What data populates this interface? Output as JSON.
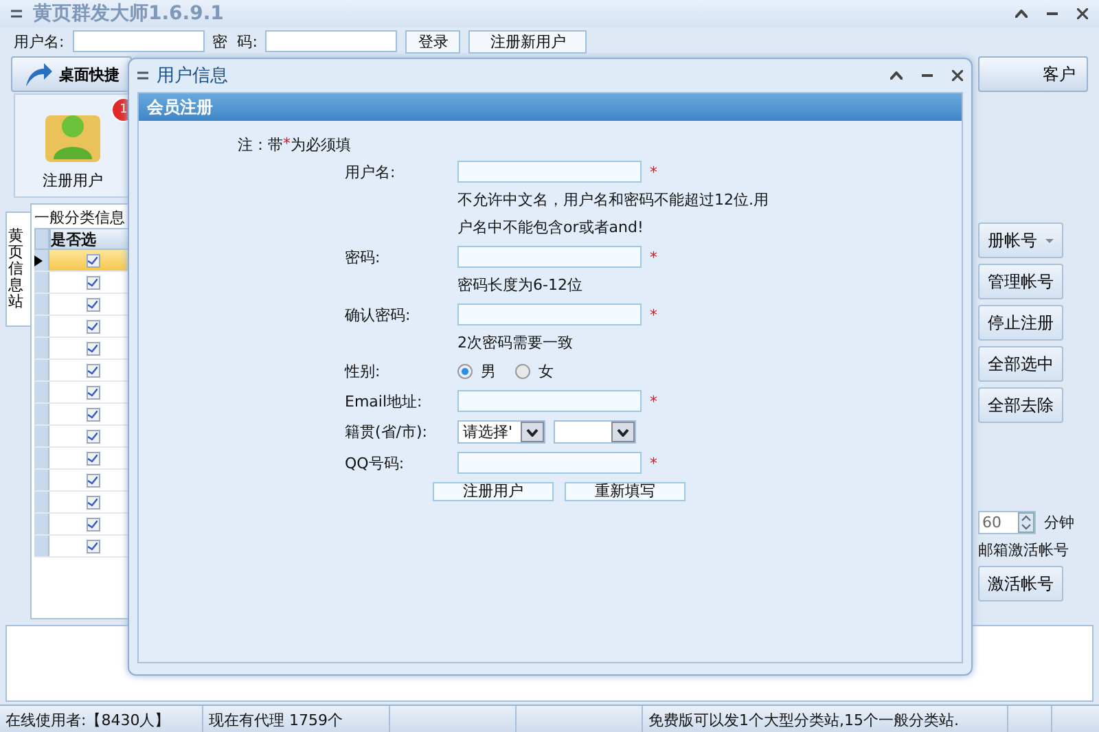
{
  "app": {
    "title": "黄页群发大师1.6.9.1"
  },
  "login": {
    "username_label": "用户名:",
    "password_label": "密  码:",
    "login_button": "登录",
    "register_button": "注册新用户"
  },
  "toolbar": {
    "desktop_button": "桌面快捷",
    "customer_button": "客户"
  },
  "shortcut": {
    "label": "注册用户",
    "badge": "1"
  },
  "side_tab": {
    "label": "黄页信息站",
    "selected": true
  },
  "grid": {
    "group_label": "一般分类信息",
    "column": "是否选",
    "rows": [
      {
        "selected": true,
        "checked": true
      },
      {
        "selected": false,
        "checked": true
      },
      {
        "selected": false,
        "checked": true
      },
      {
        "selected": false,
        "checked": true
      },
      {
        "selected": false,
        "checked": true
      },
      {
        "selected": false,
        "checked": true
      },
      {
        "selected": false,
        "checked": true
      },
      {
        "selected": false,
        "checked": true
      },
      {
        "selected": false,
        "checked": true
      },
      {
        "selected": false,
        "checked": true
      },
      {
        "selected": false,
        "checked": true
      },
      {
        "selected": false,
        "checked": true
      },
      {
        "selected": false,
        "checked": true
      },
      {
        "selected": false,
        "checked": true
      }
    ]
  },
  "actions": [
    {
      "label": "册帐号",
      "kind": "dropdown"
    },
    {
      "label": "管理帐号",
      "kind": "button"
    },
    {
      "label": "停止注册",
      "kind": "button"
    },
    {
      "label": "全部选中",
      "kind": "button"
    },
    {
      "label": "全部去除",
      "kind": "button"
    }
  ],
  "timer": {
    "value": "60",
    "unit": "分钟",
    "option": "邮箱激活帐号",
    "button": "激活帐号"
  },
  "dialog": {
    "title": "用户信息",
    "section": "会员注册",
    "note_prefix": "注：带",
    "required_mark": "*",
    "note_suffix": "为必须填",
    "fields": [
      {
        "kind": "text",
        "label": "用户名:",
        "required": true,
        "hints": [
          "不允许中文名，用户名和密码不能超过12位.用",
          "户名中不能包含or或者and!"
        ]
      },
      {
        "kind": "text",
        "label": "密码:",
        "required": true,
        "hints": [
          "密码长度为6-12位"
        ]
      },
      {
        "kind": "text",
        "label": "确认密码:",
        "required": true,
        "hints": [
          "2次密码需要一致"
        ]
      },
      {
        "kind": "radio",
        "label": "性别:",
        "options": [
          {
            "label": "男",
            "selected": true
          },
          {
            "label": "女",
            "selected": false
          }
        ]
      },
      {
        "kind": "text",
        "label": "Email地址:",
        "required": true
      },
      {
        "kind": "select",
        "label": "籍贯(省/市):",
        "selects": [
          {
            "value": "请选择'"
          },
          {
            "kind": "empty"
          }
        ]
      },
      {
        "kind": "text",
        "label": "QQ号码:",
        "required": true
      }
    ],
    "buttons": [
      "注册用户",
      "重新填写"
    ]
  },
  "status_bar": [
    {
      "text": "在线使用者:【8430人】"
    },
    {
      "text": "现在有代理 1759个"
    },
    {
      "text": "免费版可以发1个大型分类站,15个一般分类站."
    }
  ]
}
